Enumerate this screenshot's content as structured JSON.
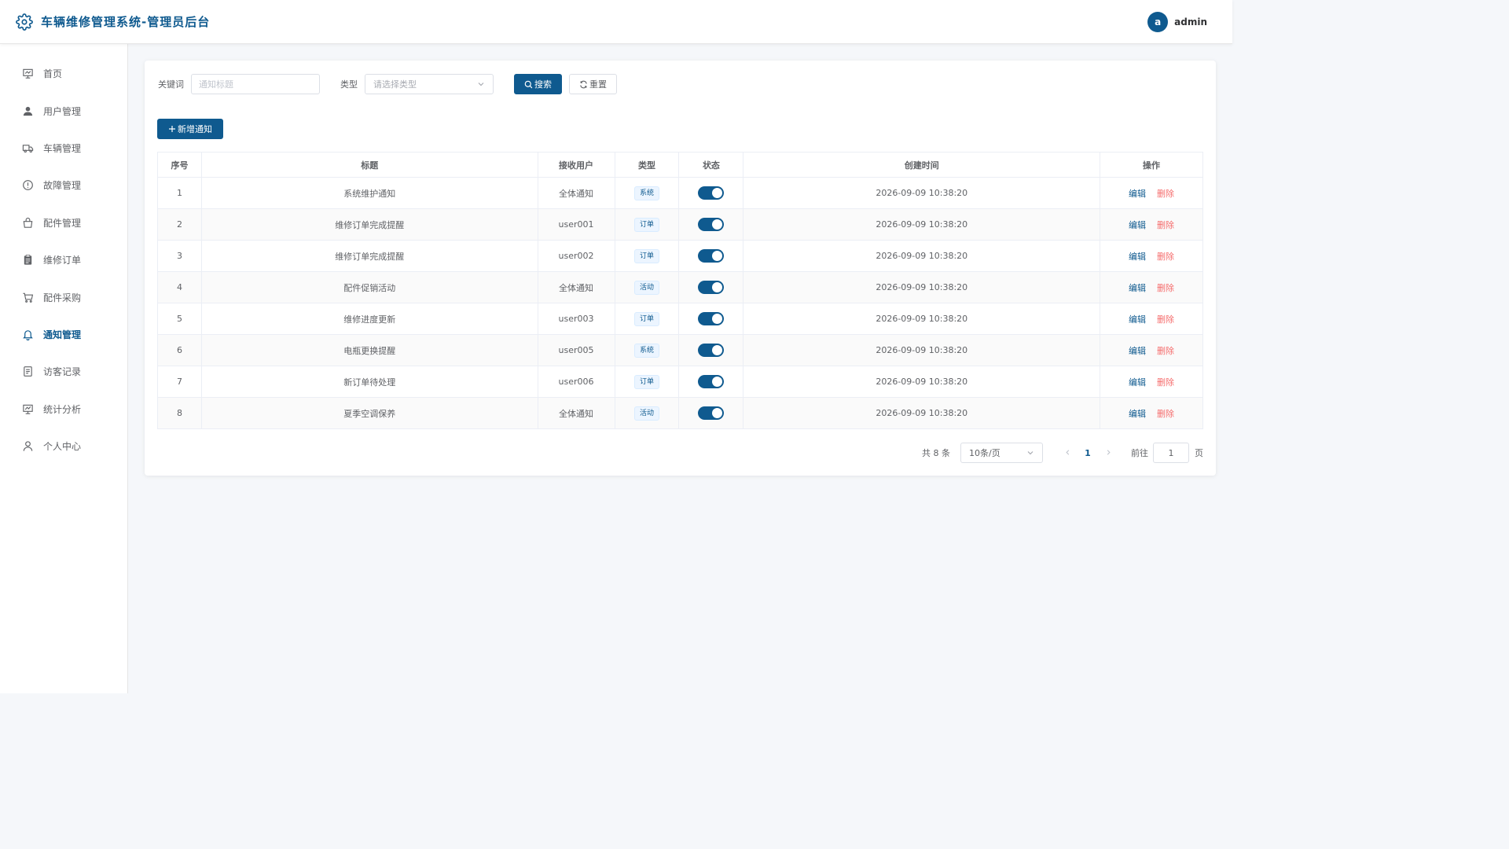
{
  "header": {
    "title": "车辆维修管理系统-管理员后台",
    "avatar_letter": "a",
    "username": "admin"
  },
  "sidebar": {
    "items": [
      {
        "label": "首页",
        "icon": "monitor-icon",
        "active": false
      },
      {
        "label": "用户管理",
        "icon": "user-icon",
        "active": false
      },
      {
        "label": "车辆管理",
        "icon": "truck-icon",
        "active": false
      },
      {
        "label": "故障管理",
        "icon": "warning-icon",
        "active": false
      },
      {
        "label": "配件管理",
        "icon": "box-icon",
        "active": false
      },
      {
        "label": "维修订单",
        "icon": "clipboard-icon",
        "active": false
      },
      {
        "label": "配件采购",
        "icon": "cart-icon",
        "active": false
      },
      {
        "label": "通知管理",
        "icon": "bell-icon",
        "active": true
      },
      {
        "label": "访客记录",
        "icon": "document-icon",
        "active": false
      },
      {
        "label": "统计分析",
        "icon": "chart-icon",
        "active": false
      },
      {
        "label": "个人中心",
        "icon": "person-icon",
        "active": false
      }
    ]
  },
  "filters": {
    "keyword_label": "关键词",
    "keyword_placeholder": "通知标题",
    "type_label": "类型",
    "type_placeholder": "请选择类型",
    "search_label": "搜索",
    "reset_label": "重置"
  },
  "add_button": "新增通知",
  "table": {
    "headers": [
      "序号",
      "标题",
      "接收用户",
      "类型",
      "状态",
      "创建时间",
      "操作"
    ],
    "rows": [
      {
        "no": "1",
        "title": "系统维护通知",
        "receiver": "全体通知",
        "type": "系统",
        "enabled": true,
        "created": "2026-09-09 10:38:20"
      },
      {
        "no": "2",
        "title": "维修订单完成提醒",
        "receiver": "user001",
        "type": "订单",
        "enabled": true,
        "created": "2026-09-09 10:38:20"
      },
      {
        "no": "3",
        "title": "维修订单完成提醒",
        "receiver": "user002",
        "type": "订单",
        "enabled": true,
        "created": "2026-09-09 10:38:20"
      },
      {
        "no": "4",
        "title": "配件促销活动",
        "receiver": "全体通知",
        "type": "活动",
        "enabled": true,
        "created": "2026-09-09 10:38:20"
      },
      {
        "no": "5",
        "title": "维修进度更新",
        "receiver": "user003",
        "type": "订单",
        "enabled": true,
        "created": "2026-09-09 10:38:20"
      },
      {
        "no": "6",
        "title": "电瓶更换提醒",
        "receiver": "user005",
        "type": "系统",
        "enabled": true,
        "created": "2026-09-09 10:38:20"
      },
      {
        "no": "7",
        "title": "新订单待处理",
        "receiver": "user006",
        "type": "订单",
        "enabled": true,
        "created": "2026-09-09 10:38:20"
      },
      {
        "no": "8",
        "title": "夏季空调保养",
        "receiver": "全体通知",
        "type": "活动",
        "enabled": true,
        "created": "2026-09-09 10:38:20"
      }
    ],
    "edit_label": "编辑",
    "delete_label": "删除"
  },
  "pagination": {
    "total_text": "共 8 条",
    "page_size": "10条/页",
    "current_page": "1",
    "goto_label": "前往",
    "goto_value": "1",
    "page_suffix": "页"
  },
  "colors": {
    "primary": "#0f5a8f",
    "danger": "#f56c6c",
    "background": "#f5f7fa"
  }
}
